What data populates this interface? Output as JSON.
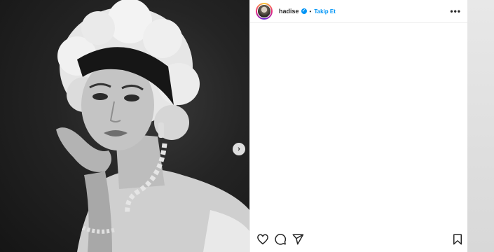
{
  "post": {
    "username": "hadise",
    "separator": "•",
    "follow_label": "Takip Et",
    "more_label": "•••",
    "verified": true
  },
  "carousel": {
    "next_label": "›"
  },
  "icons": {
    "like": "heart-icon",
    "comment": "comment-icon",
    "share": "send-icon",
    "save": "bookmark-icon",
    "next": "chevron-right-icon",
    "more": "more-dots-icon",
    "verified": "verified-badge-icon"
  },
  "colors": {
    "accent": "#0095f6",
    "text": "#262626"
  }
}
